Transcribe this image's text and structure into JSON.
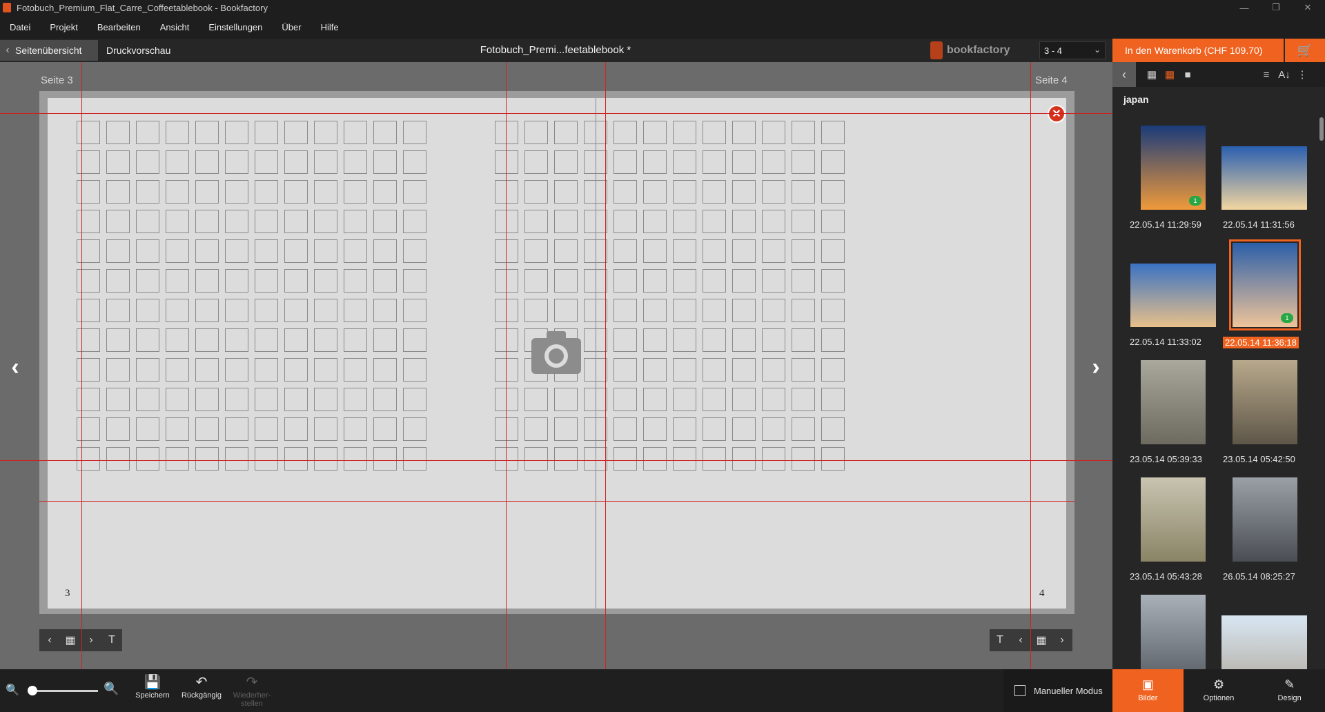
{
  "window": {
    "title": "Fotobuch_Premium_Flat_Carre_Coffeetablebook - Bookfactory"
  },
  "menu": [
    "Datei",
    "Projekt",
    "Bearbeiten",
    "Ansicht",
    "Einstellungen",
    "Über",
    "Hilfe"
  ],
  "toolbar": {
    "back_label": "Seitenübersicht",
    "print_preview_label": "Druckvorschau",
    "doc_title": "Fotobuch_Premi...feetablebook *",
    "brand": "bookfactory",
    "page_select_value": "3 - 4",
    "cart_label": "In den Warenkorb (CHF 109.70)"
  },
  "canvas": {
    "left_page_label": "Seite 3",
    "right_page_label": "Seite 4",
    "left_page_number": "3",
    "right_page_number": "4"
  },
  "bottom": {
    "save": "Speichern",
    "undo": "Rückgängig",
    "redo_line1": "Wiederher-",
    "redo_line2": "stellen",
    "manual_mode": "Manueller Modus"
  },
  "sidebar": {
    "folder": "japan",
    "thumbnails": [
      {
        "caption": "22.05.14 11:29:59",
        "badge": "1",
        "selected": false,
        "colors": [
          "#1a3b7a",
          "#f09a3a"
        ]
      },
      {
        "caption": "22.05.14 11:31:56",
        "badge": "",
        "selected": false,
        "colors": [
          "#2a5fb0",
          "#f2d6a0"
        ]
      },
      {
        "caption": "22.05.14 11:33:02",
        "badge": "",
        "selected": false,
        "colors": [
          "#3a72c2",
          "#e8c08a"
        ]
      },
      {
        "caption": "22.05.14 11:36:18",
        "badge": "1",
        "selected": true,
        "colors": [
          "#2b5fa8",
          "#efc49a"
        ]
      },
      {
        "caption": "23.05.14 05:39:33",
        "badge": "",
        "selected": false,
        "colors": [
          "#a9a89c",
          "#6d6a60"
        ]
      },
      {
        "caption": "23.05.14 05:42:50",
        "badge": "",
        "selected": false,
        "colors": [
          "#b8a98c",
          "#5e5648"
        ]
      },
      {
        "caption": "23.05.14 05:43:28",
        "badge": "",
        "selected": false,
        "colors": [
          "#c8c4b0",
          "#8a8466"
        ]
      },
      {
        "caption": "26.05.14 08:25:27",
        "badge": "",
        "selected": false,
        "colors": [
          "#9aa0a6",
          "#4a4e54"
        ]
      },
      {
        "caption": "",
        "badge": "",
        "selected": false,
        "colors": [
          "#a9b0b8",
          "#5c6168"
        ]
      },
      {
        "caption": "",
        "badge": "",
        "selected": false,
        "colors": [
          "#d8e6f2",
          "#b8b4ac"
        ]
      }
    ],
    "tabs": [
      "Bilder",
      "Optionen",
      "Design"
    ]
  }
}
